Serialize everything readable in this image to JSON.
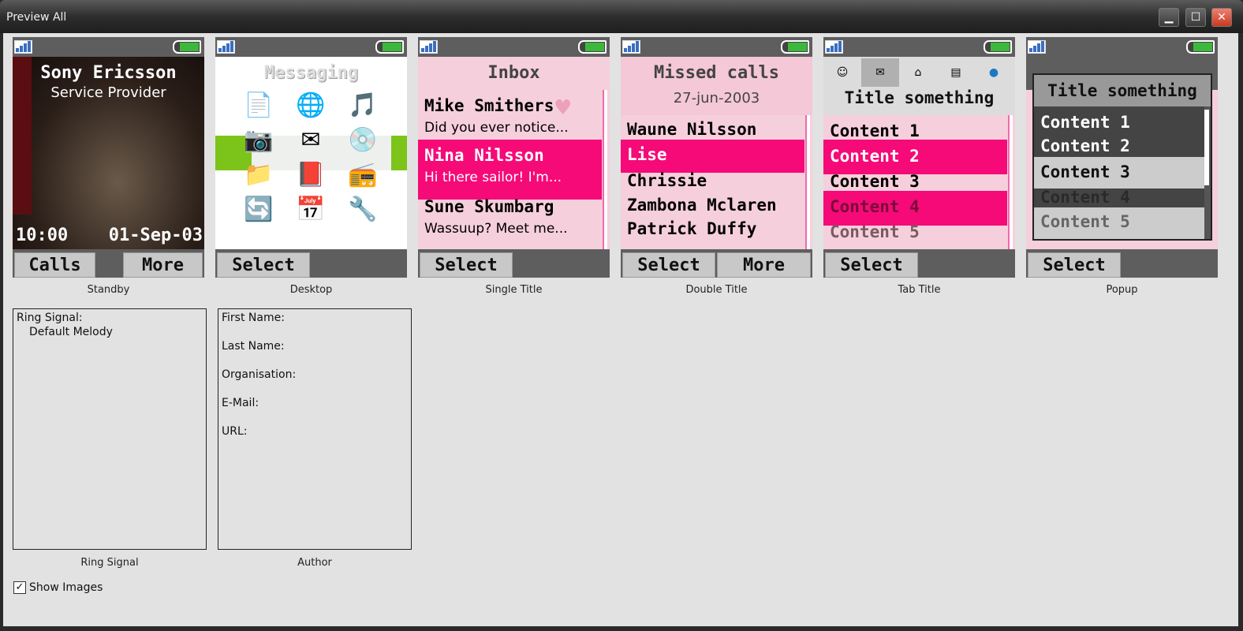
{
  "window": {
    "title": "Preview All",
    "minimize": "▁",
    "maximize": "☐",
    "close": "✕"
  },
  "phones": [
    {
      "label": "Standby",
      "operator": "Sony Ericsson",
      "provider": "Service Provider",
      "time": "10:00",
      "date": "01-Sep-03",
      "left_soft": "Calls",
      "right_soft": "More"
    },
    {
      "label": "Desktop",
      "title": "Messaging",
      "left_soft": "Select"
    },
    {
      "label": "Single Title",
      "title": "Inbox",
      "items": [
        {
          "name": "Mike Smithers",
          "preview": "Did you ever notice..."
        },
        {
          "name": "Nina Nilsson",
          "preview": "Hi there sailor! I'm..."
        },
        {
          "name": "Sune Skumbarg",
          "preview": "Wassuup?  Meet me..."
        }
      ],
      "left_soft": "Select"
    },
    {
      "label": "Double Title",
      "title": "Missed calls",
      "subtitle": "27-jun-2003",
      "items": [
        "Waune Nilsson",
        "Lise",
        "Chrissie",
        "Zambona Mclaren",
        "Patrick Duffy"
      ],
      "left_soft": "Select",
      "right_soft": "More"
    },
    {
      "label": "Tab Title",
      "tabs": [
        "smiley-icon",
        "messaging-icon",
        "home-icon",
        "document-icon",
        "globe-icon"
      ],
      "title": "Title something",
      "items": [
        "Content 1",
        "Content 2",
        "Content 3",
        "Content 4",
        "Content 5"
      ],
      "left_soft": "Select"
    },
    {
      "label": "Popup",
      "title": "Title something",
      "items": [
        "Content 1",
        "Content 2",
        "Content 3",
        "Content 4",
        "Content 5"
      ],
      "left_soft": "Select"
    }
  ],
  "ring_signal": {
    "label": "Ring Signal",
    "field": "Ring Signal:",
    "value": "Default Melody"
  },
  "author": {
    "label": "Author",
    "fields": [
      "First Name:",
      "Last Name:",
      "Organisation:",
      "E-Mail:",
      "URL:"
    ]
  },
  "show_images": {
    "label": "Show Images",
    "checked": true
  },
  "colors": {
    "highlight": "#f50a78",
    "battery": "#3cb83c",
    "list_bg": "#f6cfdc"
  }
}
